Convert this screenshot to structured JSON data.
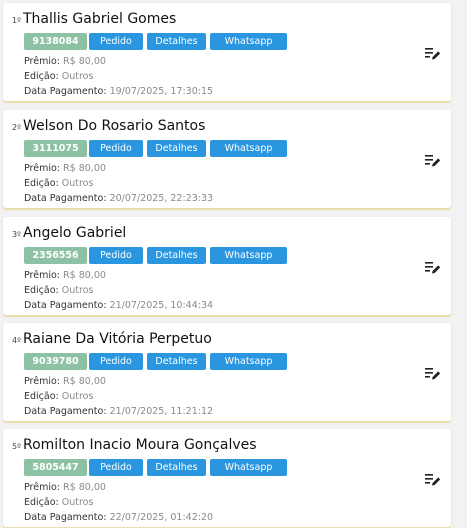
{
  "labels": {
    "premio": "Prêmio:",
    "edicao": "Edição:",
    "data_pagamento": "Data Pagamento:",
    "pedido_button": "Pedido",
    "detalhes_button": "Detalhes",
    "whatsapp_button": "Whatsapp"
  },
  "entries": [
    {
      "rank": "1º",
      "name": "Thallis Gabriel Gomes",
      "id": "9138084",
      "premio": "R$ 80,00",
      "edicao": "Outros",
      "data_pagamento": "19/07/2025, 17:30:15"
    },
    {
      "rank": "2º",
      "name": "Welson Do Rosario Santos",
      "id": "3111075",
      "premio": "R$ 80,00",
      "edicao": "Outros",
      "data_pagamento": "20/07/2025, 22:23:33"
    },
    {
      "rank": "3º",
      "name": "Angelo Gabriel",
      "id": "2356556",
      "premio": "R$ 80,00",
      "edicao": "Outros",
      "data_pagamento": "21/07/2025, 10:44:34"
    },
    {
      "rank": "4º",
      "name": "Raiane Da Vitória Perpetuo",
      "id": "9039780",
      "premio": "R$ 80,00",
      "edicao": "Outros",
      "data_pagamento": "21/07/2025, 11:21:12"
    },
    {
      "rank": "5º",
      "name": "Romilton Inacio Moura Gonçalves",
      "id": "5805447",
      "premio": "R$ 80,00",
      "edicao": "Outros",
      "data_pagamento": "22/07/2025, 01:42:20"
    }
  ],
  "icons": {
    "edit": "edit-list-icon"
  },
  "colors": {
    "id_badge": "#8cc2a3",
    "action_button": "#2a96e0",
    "card_shadow": "#e9dfae"
  }
}
